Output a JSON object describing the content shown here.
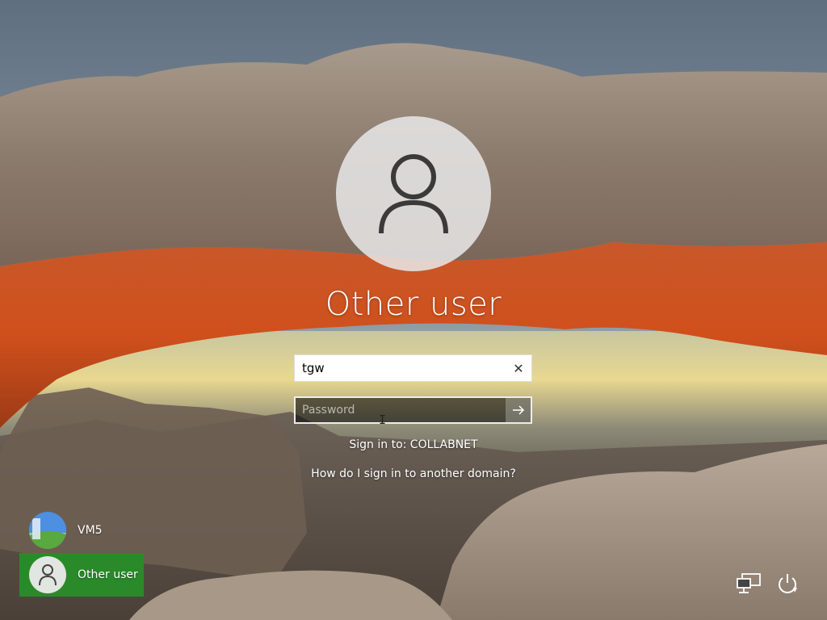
{
  "login": {
    "display_name": "Other user",
    "username_value": "tgw",
    "password_placeholder": "Password",
    "sign_in_to": "Sign in to: COLLABNET",
    "another_domain_link": "How do I sign in to another domain?"
  },
  "users": [
    {
      "label": "VM5",
      "avatar": "windows-xp-wallpaper-avatar",
      "selected": false
    },
    {
      "label": "Other user",
      "avatar": "default-user-avatar",
      "selected": true
    }
  ],
  "system_icons": [
    "network-icon",
    "power-icon"
  ],
  "colors": {
    "selected_tile": "#2a8a2a",
    "password_box_bg": "#2b2b2b",
    "arrow_button_bg": "#7a7a7a"
  }
}
